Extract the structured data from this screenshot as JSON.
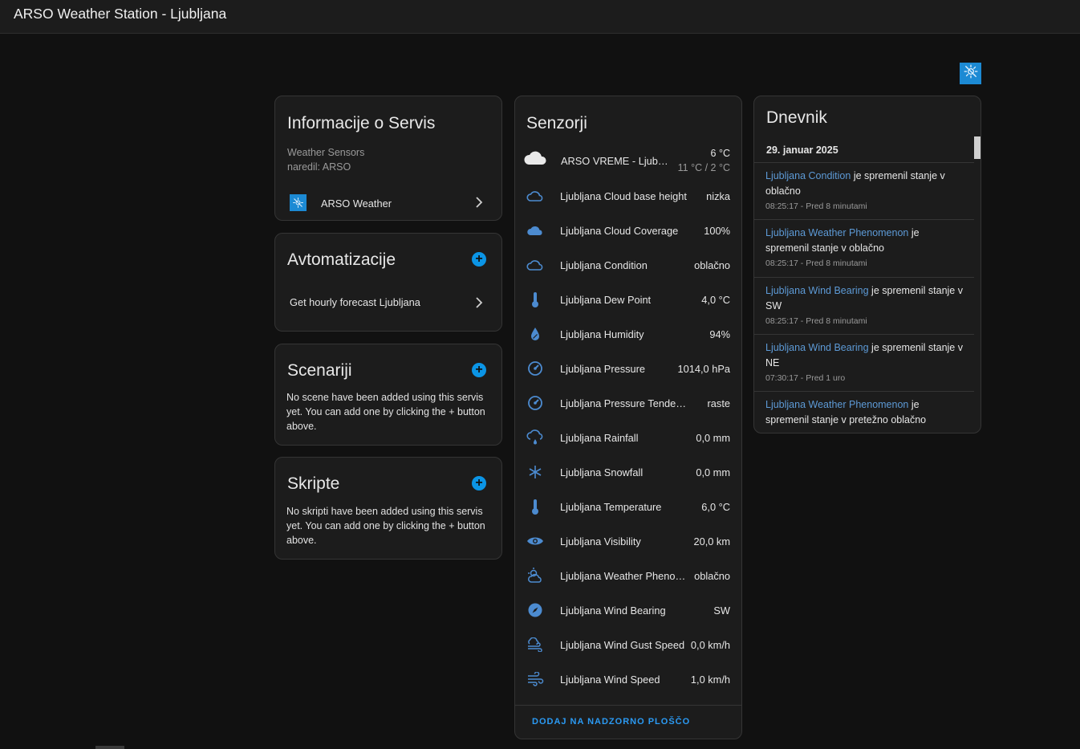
{
  "header": {
    "title": "ARSO Weather Station - Ljubljana"
  },
  "brand": {
    "icon": "sun-snowflake-icon",
    "color": "#1c8ad4"
  },
  "info_card": {
    "title": "Informacije o Servis",
    "model": "Weather Sensors",
    "manufacturer": "naredil: ARSO",
    "integration_label": "ARSO Weather"
  },
  "automations_card": {
    "title": "Avtomatizacije",
    "items": [
      "Get hourly forecast Ljubljana"
    ]
  },
  "scenes_card": {
    "title": "Scenariji",
    "empty_text": "No scene have been added using this servis yet. You can add one by clicking the + button above."
  },
  "scripts_card": {
    "title": "Skripte",
    "empty_text": "No skripti have been added using this servis yet. You can add one by clicking the + button above."
  },
  "sensors_card": {
    "title": "Senzorji",
    "weather": {
      "name": "ARSO VREME - Ljubljana",
      "temp": "6 °C",
      "range": "11 °C / 2 °C",
      "icon": "cloud-icon"
    },
    "rows": [
      {
        "name": "Ljubljana Cloud base height",
        "value": "nizka",
        "icon": "cloud-outline-icon"
      },
      {
        "name": "Ljubljana Cloud Coverage",
        "value": "100%",
        "icon": "cloud-filled-icon"
      },
      {
        "name": "Ljubljana Condition",
        "value": "oblačno",
        "icon": "cloud-outline-icon"
      },
      {
        "name": "Ljubljana Dew Point",
        "value": "4,0 °C",
        "icon": "thermometer-icon"
      },
      {
        "name": "Ljubljana Humidity",
        "value": "94%",
        "icon": "water-percent-icon"
      },
      {
        "name": "Ljubljana Pressure",
        "value": "1014,0 hPa",
        "icon": "gauge-icon"
      },
      {
        "name": "Ljubljana Pressure Tendency",
        "value": "raste",
        "icon": "gauge-icon"
      },
      {
        "name": "Ljubljana Rainfall",
        "value": "0,0 mm",
        "icon": "weather-rainy-icon"
      },
      {
        "name": "Ljubljana Snowfall",
        "value": "0,0 mm",
        "icon": "snowflake-icon"
      },
      {
        "name": "Ljubljana Temperature",
        "value": "6,0 °C",
        "icon": "thermometer-icon"
      },
      {
        "name": "Ljubljana Visibility",
        "value": "20,0 km",
        "icon": "eye-icon"
      },
      {
        "name": "Ljubljana Weather Phenomenon",
        "value": "oblačno",
        "icon": "weather-partly-icon"
      },
      {
        "name": "Ljubljana Wind Bearing",
        "value": "SW",
        "icon": "compass-icon"
      },
      {
        "name": "Ljubljana Wind Gust Speed",
        "value": "0,0 km/h",
        "icon": "weather-windy-icon"
      },
      {
        "name": "Ljubljana Wind Speed",
        "value": "1,0 km/h",
        "icon": "wind-icon"
      }
    ],
    "footer_action": "DODAJ NA NADZORNO PLOŠČO"
  },
  "logbook_card": {
    "title": "Dnevnik",
    "date": "29. januar 2025",
    "entries": [
      {
        "entity": "Ljubljana Condition",
        "text": " je spremenil stanje v oblačno",
        "time": "08:25:17 - Pred 8 minutami"
      },
      {
        "entity": "Ljubljana Weather Phenomenon",
        "text": " je spremenil stanje v oblačno",
        "time": "08:25:17 - Pred 8 minutami"
      },
      {
        "entity": "Ljubljana Wind Bearing",
        "text": " je spremenil stanje v SW",
        "time": "08:25:17 - Pred 8 minutami"
      },
      {
        "entity": "Ljubljana Wind Bearing",
        "text": " je spremenil stanje v NE",
        "time": "07:30:17 - Pred 1 uro"
      },
      {
        "entity": "Ljubljana Weather Phenomenon",
        "text": " je spremenil stanje v pretežno oblačno",
        "time": ""
      }
    ]
  }
}
